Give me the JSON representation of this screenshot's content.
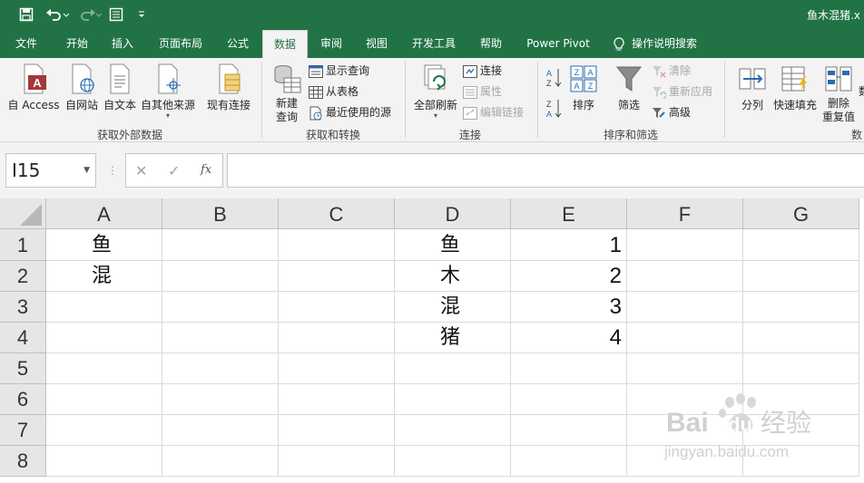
{
  "qat": {
    "save_icon": "save-icon",
    "undo_icon": "undo-icon",
    "redo_icon": "redo-icon",
    "form_icon": "form-icon",
    "customize_icon": "customize-qat-icon"
  },
  "title": "鱼木混猪.x",
  "tabs": [
    "文件",
    "开始",
    "插入",
    "页面布局",
    "公式",
    "数据",
    "审阅",
    "视图",
    "开发工具",
    "帮助",
    "Power Pivot"
  ],
  "active_tab": "数据",
  "tell_me": "操作说明搜索",
  "ribbon": {
    "get_external": {
      "label": "获取外部数据",
      "access": "自 Access",
      "web": "自网站",
      "text": "自文本",
      "other": "自其他来源"
    },
    "existing": "现有连接",
    "get_transform": {
      "label": "获取和转换",
      "new_query_line1": "新建",
      "new_query_line2": "查询",
      "show_queries": "显示查询",
      "from_table": "从表格",
      "recent_sources": "最近使用的源"
    },
    "connections": {
      "label": "连接",
      "refresh_all": "全部刷新",
      "connections": "连接",
      "properties": "属性",
      "edit_links": "编辑链接"
    },
    "sort_filter": {
      "label": "排序和筛选",
      "sort": "排序",
      "filter": "筛选",
      "clear": "清除",
      "reapply": "重新应用",
      "advanced": "高级"
    },
    "data_tools": {
      "label": "数",
      "split": "分列",
      "flash_fill": "快速填充",
      "remove_dup_line1": "删除",
      "remove_dup_line2": "重复值",
      "cut_label": "数"
    }
  },
  "formula_bar": {
    "name_box": "I15",
    "fx": "fx",
    "cancel": "✕",
    "enter": "✓",
    "value": ""
  },
  "columns": [
    "A",
    "B",
    "C",
    "D",
    "E",
    "F",
    "G"
  ],
  "rows": [
    "1",
    "2",
    "3",
    "4",
    "5",
    "6",
    "7",
    "8"
  ],
  "cells": {
    "A1": "鱼",
    "A2": "混",
    "D1": "鱼",
    "D2": "木",
    "D3": "混",
    "D4": "猪",
    "E1": "1",
    "E2": "2",
    "E3": "3",
    "E4": "4"
  },
  "watermark": {
    "brand": "Bai",
    "brand2": "du",
    "cn": "经验",
    "url": "jingyan.baidu.com"
  },
  "colors": {
    "excel_green": "#217346",
    "ribbon_bg": "#f3f3f3",
    "header_bg": "#e6e6e6",
    "gridline": "#dadada"
  }
}
